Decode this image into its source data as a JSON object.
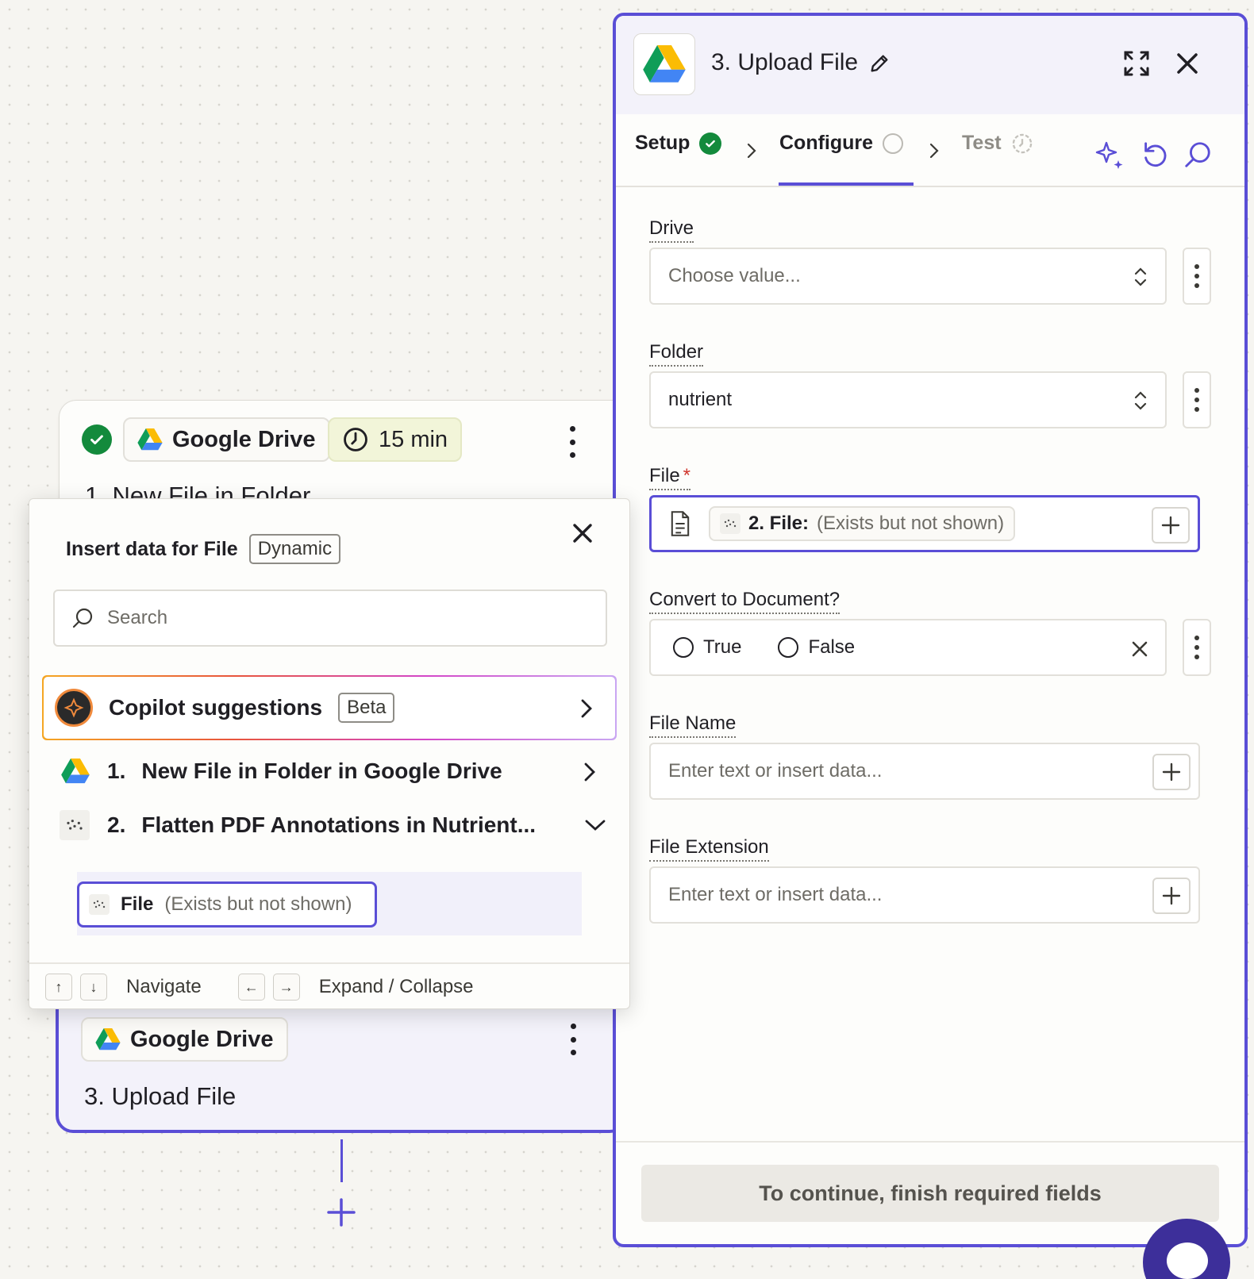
{
  "canvas": {
    "step1": {
      "app_chip": "Google Drive",
      "time_chip": "15 min",
      "title": "1. New File in Folder"
    },
    "step3": {
      "app_chip": "Google Drive",
      "title": "3. Upload File"
    }
  },
  "panel": {
    "title": "3. Upload File",
    "tabs": [
      {
        "label": "Setup",
        "status": "complete"
      },
      {
        "label": "Configure",
        "status": "active"
      },
      {
        "label": "Test",
        "status": "pending"
      }
    ],
    "fields": {
      "drive": {
        "label": "Drive",
        "placeholder": "Choose value..."
      },
      "folder": {
        "label": "Folder",
        "value": "nutrient"
      },
      "file": {
        "label": "File",
        "required_mark": "*",
        "pill_label": "2. File:",
        "pill_note": "(Exists but not shown)"
      },
      "convert": {
        "label": "Convert to Document?",
        "options": [
          "True",
          "False"
        ]
      },
      "file_name": {
        "label": "File Name",
        "placeholder": "Enter text or insert data..."
      },
      "file_extension": {
        "label": "File Extension",
        "placeholder": "Enter text or insert data..."
      }
    },
    "continue_label": "To continue, finish required fields"
  },
  "popup": {
    "title": "Insert data for File",
    "tag": "Dynamic",
    "search_placeholder": "Search",
    "copilot": {
      "label": "Copilot suggestions",
      "tag": "Beta"
    },
    "tree": [
      {
        "num": "1.",
        "label": "New File in Folder in Google Drive"
      },
      {
        "num": "2.",
        "label": "Flatten PDF Annotations in Nutrient..."
      }
    ],
    "sub_item": {
      "label": "File",
      "note": "(Exists but not shown)"
    },
    "footer": {
      "navigate": "Navigate",
      "expand": "Expand / Collapse",
      "keys": [
        "↑",
        "↓",
        "←",
        "→"
      ]
    }
  },
  "colors": {
    "accent": "#5a4ed6",
    "success": "#138a3c",
    "required": "#d0362d"
  }
}
